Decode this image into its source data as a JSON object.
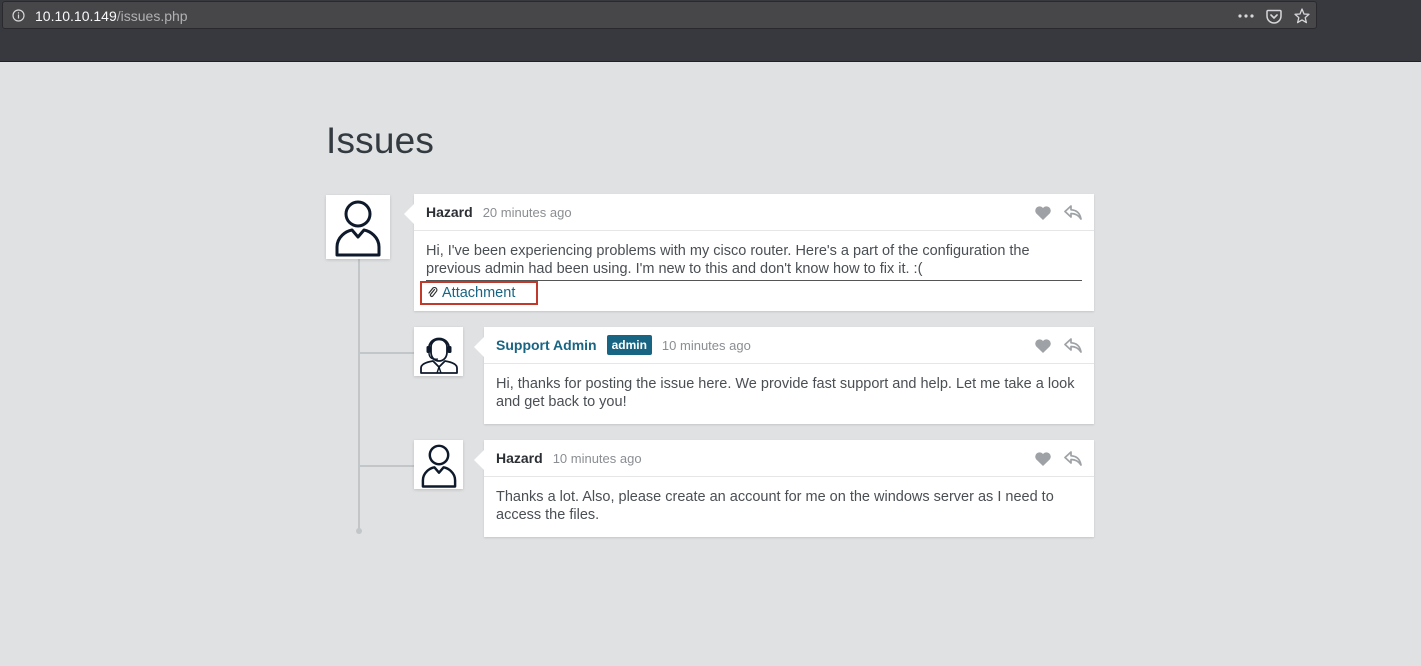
{
  "browser": {
    "url_host": "10.10.10.149",
    "url_path": "/issues.php"
  },
  "page": {
    "title": "Issues"
  },
  "comments": [
    {
      "author": "Hazard",
      "time": "20 minutes ago",
      "body": "Hi, I've been experiencing problems with my cisco router. Here's a part of the configuration the previous admin had been using. I'm new to this and don't know how to fix it. :(",
      "attachment_label": "Attachment"
    },
    {
      "author": "Support Admin",
      "badge": "admin",
      "time": "10 minutes ago",
      "body": "Hi, thanks for posting the issue here. We provide fast support and help. Let me take a look and get back to you!"
    },
    {
      "author": "Hazard",
      "time": "10 minutes ago",
      "body": "Thanks a lot. Also, please create an account for me on the windows server as I need to access the files."
    }
  ],
  "colors": {
    "accent": "#186583",
    "highlight_box": "#c0392b",
    "background": "#dfe1e3"
  }
}
